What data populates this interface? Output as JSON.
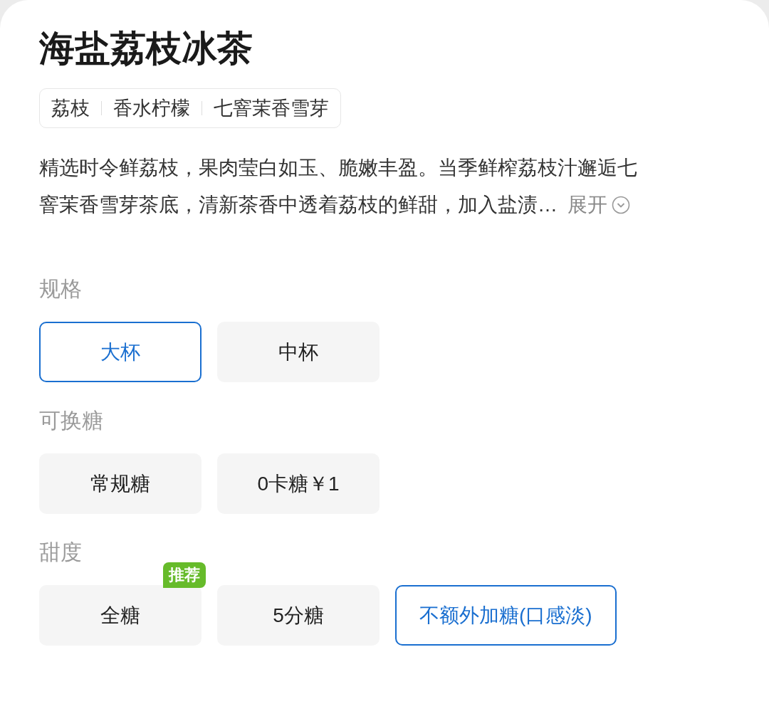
{
  "product": {
    "title": "海盐荔枝冰茶",
    "tags": [
      "荔枝",
      "香水柠檬",
      "七窨茉香雪芽"
    ],
    "description_lines": [
      "精选时令鲜荔枝，果肉莹白如玉、脆嫩丰盈。当季鲜榨荔枝汁邂逅七",
      "窨茉香雪芽茶底，清新茶香中透着荔枝的鲜甜，加入盐渍…"
    ],
    "expand_label": "展开"
  },
  "option_groups": [
    {
      "label": "规格",
      "options": [
        {
          "label": "大杯",
          "selected": true
        },
        {
          "label": "中杯",
          "selected": false
        }
      ]
    },
    {
      "label": "可换糖",
      "options": [
        {
          "label": "常规糖",
          "selected": false
        },
        {
          "label": "0卡糖￥1",
          "selected": false
        }
      ]
    },
    {
      "label": "甜度",
      "options": [
        {
          "label": "全糖",
          "selected": false,
          "badge": "推荐"
        },
        {
          "label": "5分糖",
          "selected": false
        },
        {
          "label": "不额外加糖(口感淡)",
          "selected": true
        }
      ]
    }
  ]
}
